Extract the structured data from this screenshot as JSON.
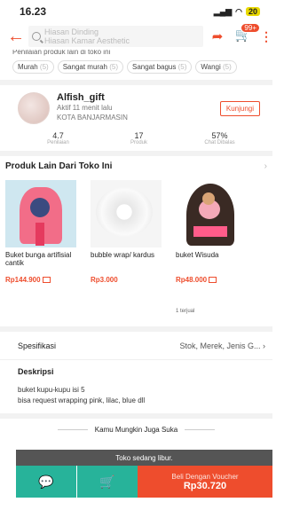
{
  "status_bar": {
    "time": "16.23",
    "battery": "20"
  },
  "header": {
    "search_lines": [
      "Hiasan Dinding",
      "Hiasan Kamar Aesthetic"
    ],
    "cart_badge": "99+"
  },
  "reviews": {
    "cut_title": "Penilaian produk lain di toko ini",
    "chips": [
      {
        "label": "Murah",
        "count": "(5)"
      },
      {
        "label": "Sangat murah",
        "count": "(5)"
      },
      {
        "label": "Sangat bagus",
        "count": "(5)"
      },
      {
        "label": "Wangi",
        "count": "(5)"
      }
    ]
  },
  "shop": {
    "name": "Alfish_gift",
    "active": "Aktif 11 menit lalu",
    "city": "KOTA BANJARMASIN",
    "visit_label": "Kunjungi",
    "stats": [
      {
        "value": "4.7",
        "label": "Penilaian"
      },
      {
        "value": "17",
        "label": "Produk"
      },
      {
        "value": "57%",
        "label": "Chat Dibalas"
      }
    ]
  },
  "other_products": {
    "title": "Produk Lain Dari Toko Ini",
    "chevron": "›",
    "items": [
      {
        "name": "Buket bunga artifisial cantik",
        "price": "Rp144.900",
        "sold": ""
      },
      {
        "name": "bubble wrap/ kardus",
        "price": "Rp3.000",
        "sold": ""
      },
      {
        "name": "buket Wisuda",
        "price": "Rp48.000",
        "sold": "1 terjual"
      }
    ]
  },
  "spec": {
    "label": "Spesifikasi",
    "value": "Stok, Merek, Jenis G...",
    "chevron": "›"
  },
  "description": {
    "title": "Deskripsi",
    "lines": [
      "buket kupu-kupu isi 5",
      "bisa request wrapping pink, lilac, blue dll"
    ]
  },
  "suggest_title": "Kamu Mungkin Juga Suka",
  "toast": "Toko sedang libur.",
  "bottom_bar": {
    "buy_label": "Beli Dengan Voucher",
    "buy_price": "Rp30.720"
  },
  "colors": {
    "accent": "#ee4d2d",
    "teal": "#27b39a"
  }
}
